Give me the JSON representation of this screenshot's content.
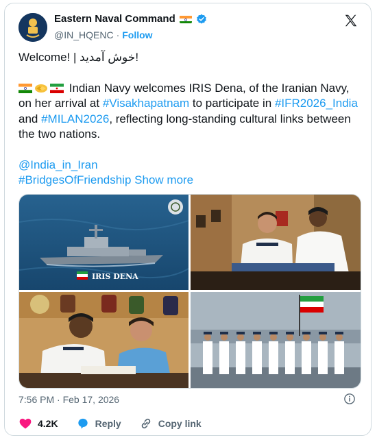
{
  "account": {
    "name": "Eastern Naval Command",
    "handle": "@IN_HQENC",
    "separator": "·",
    "follow_label": "Follow"
  },
  "tweet": {
    "greeting": "Welcome! | خوش آمدید!",
    "line1_text": " Indian Navy welcomes IRIS Dena, of the Iranian Navy, on her arrival at ",
    "hashtag_visakhapatnam": "#Visakhapatnam",
    "line1_after": " to participate in ",
    "hashtag_ifr": "#IFR2026_India",
    "and_text": " and ",
    "hashtag_milan": "#MILAN2026",
    "line1_end": ", reflecting long-standing cultural links between the two nations.",
    "mention": "@India_in_Iran",
    "hashtag_bridges": "#BridgesOfFriendship",
    "show_more": "Show more"
  },
  "media": {
    "ship_caption": "IRIS DENA"
  },
  "footer": {
    "timestamp": "7:56 PM · Feb 17, 2026",
    "likes": "4.2K",
    "reply_label": "Reply",
    "copy_link_label": "Copy link"
  },
  "icons": {
    "x_logo": "x-logo-icon",
    "verified": "verified-badge-icon",
    "info": "info-icon",
    "heart": "heart-icon",
    "reply": "reply-icon",
    "link": "link-icon"
  },
  "colors": {
    "link": "#1d9bf0",
    "muted": "#536471",
    "like": "#f91880"
  }
}
